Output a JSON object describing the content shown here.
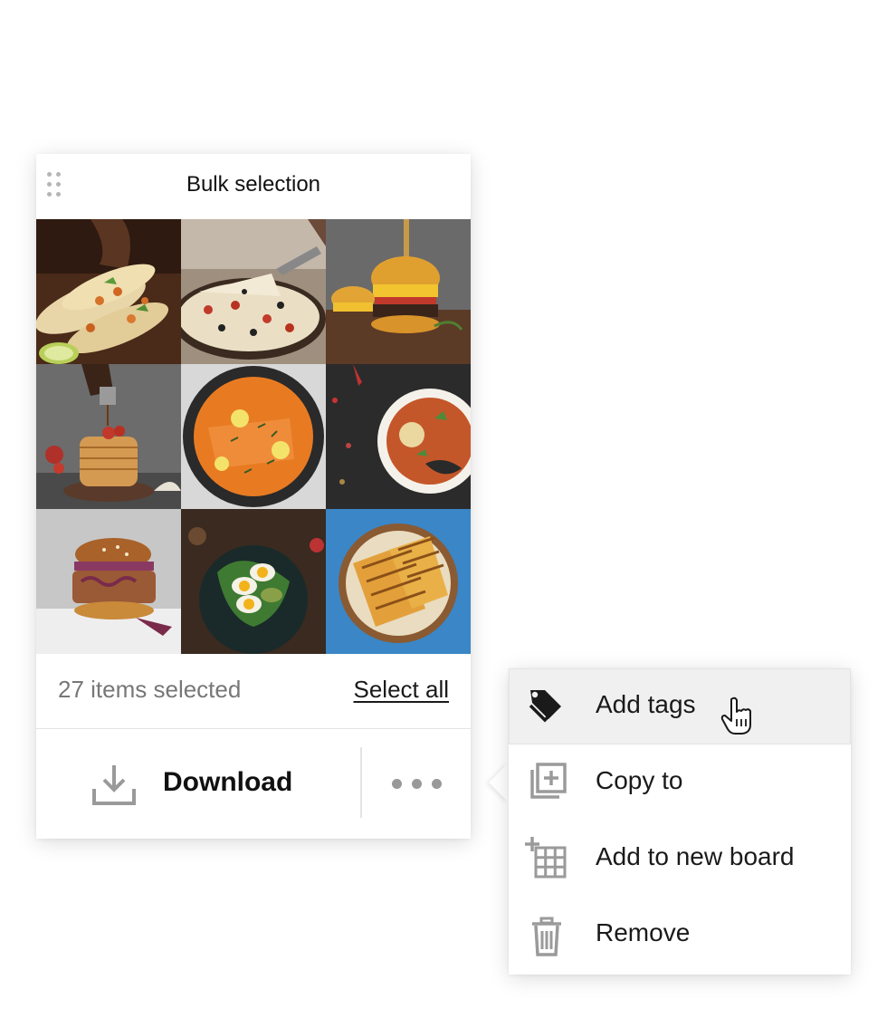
{
  "panel": {
    "title": "Bulk selection",
    "photos": [
      {
        "name": "tacos",
        "icon": "tacos-photo"
      },
      {
        "name": "pizza",
        "icon": "pizza-photo"
      },
      {
        "name": "burger",
        "icon": "burger-photo"
      },
      {
        "name": "pancakes",
        "icon": "pancakes-photo"
      },
      {
        "name": "salmon-curry",
        "icon": "salmon-curry-photo"
      },
      {
        "name": "soup",
        "icon": "soup-photo"
      },
      {
        "name": "pulled-pork-burger",
        "icon": "pulled-pork-burger-photo"
      },
      {
        "name": "egg-salad",
        "icon": "egg-salad-photo"
      },
      {
        "name": "grilled-sandwich",
        "icon": "grilled-sandwich-photo"
      }
    ],
    "selected_count_text": "27 items selected",
    "select_all_label": "Select all",
    "download_label": "Download",
    "download_icon": "download-icon",
    "more_icon": "more-dots-icon"
  },
  "menu": {
    "items": [
      {
        "label": "Add tags",
        "icon": "tag-icon",
        "active": true
      },
      {
        "label": "Copy to",
        "icon": "copy-to-icon",
        "active": false
      },
      {
        "label": "Add to new board",
        "icon": "add-board-icon",
        "active": false
      },
      {
        "label": "Remove",
        "icon": "trash-icon",
        "active": false
      }
    ]
  },
  "cursor": "hand-pointer-icon",
  "colors": {
    "accent_text": "#1a1a1a",
    "muted_text": "#777777",
    "icon_gray": "#9a9a9a",
    "hover_bg": "#f0f0f0"
  }
}
